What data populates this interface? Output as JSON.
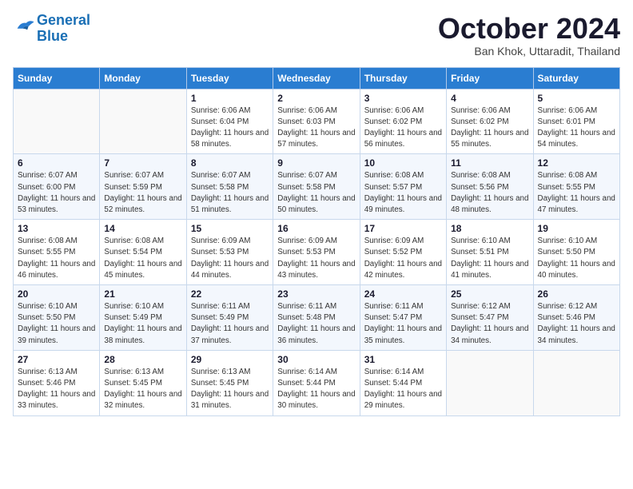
{
  "logo": {
    "line1": "General",
    "line2": "Blue"
  },
  "title": "October 2024",
  "subtitle": "Ban Khok, Uttaradit, Thailand",
  "days_header": [
    "Sunday",
    "Monday",
    "Tuesday",
    "Wednesday",
    "Thursday",
    "Friday",
    "Saturday"
  ],
  "weeks": [
    [
      {
        "day": "",
        "info": ""
      },
      {
        "day": "",
        "info": ""
      },
      {
        "day": "1",
        "info": "Sunrise: 6:06 AM\nSunset: 6:04 PM\nDaylight: 11 hours and 58 minutes."
      },
      {
        "day": "2",
        "info": "Sunrise: 6:06 AM\nSunset: 6:03 PM\nDaylight: 11 hours and 57 minutes."
      },
      {
        "day": "3",
        "info": "Sunrise: 6:06 AM\nSunset: 6:02 PM\nDaylight: 11 hours and 56 minutes."
      },
      {
        "day": "4",
        "info": "Sunrise: 6:06 AM\nSunset: 6:02 PM\nDaylight: 11 hours and 55 minutes."
      },
      {
        "day": "5",
        "info": "Sunrise: 6:06 AM\nSunset: 6:01 PM\nDaylight: 11 hours and 54 minutes."
      }
    ],
    [
      {
        "day": "6",
        "info": "Sunrise: 6:07 AM\nSunset: 6:00 PM\nDaylight: 11 hours and 53 minutes."
      },
      {
        "day": "7",
        "info": "Sunrise: 6:07 AM\nSunset: 5:59 PM\nDaylight: 11 hours and 52 minutes."
      },
      {
        "day": "8",
        "info": "Sunrise: 6:07 AM\nSunset: 5:58 PM\nDaylight: 11 hours and 51 minutes."
      },
      {
        "day": "9",
        "info": "Sunrise: 6:07 AM\nSunset: 5:58 PM\nDaylight: 11 hours and 50 minutes."
      },
      {
        "day": "10",
        "info": "Sunrise: 6:08 AM\nSunset: 5:57 PM\nDaylight: 11 hours and 49 minutes."
      },
      {
        "day": "11",
        "info": "Sunrise: 6:08 AM\nSunset: 5:56 PM\nDaylight: 11 hours and 48 minutes."
      },
      {
        "day": "12",
        "info": "Sunrise: 6:08 AM\nSunset: 5:55 PM\nDaylight: 11 hours and 47 minutes."
      }
    ],
    [
      {
        "day": "13",
        "info": "Sunrise: 6:08 AM\nSunset: 5:55 PM\nDaylight: 11 hours and 46 minutes."
      },
      {
        "day": "14",
        "info": "Sunrise: 6:08 AM\nSunset: 5:54 PM\nDaylight: 11 hours and 45 minutes."
      },
      {
        "day": "15",
        "info": "Sunrise: 6:09 AM\nSunset: 5:53 PM\nDaylight: 11 hours and 44 minutes."
      },
      {
        "day": "16",
        "info": "Sunrise: 6:09 AM\nSunset: 5:53 PM\nDaylight: 11 hours and 43 minutes."
      },
      {
        "day": "17",
        "info": "Sunrise: 6:09 AM\nSunset: 5:52 PM\nDaylight: 11 hours and 42 minutes."
      },
      {
        "day": "18",
        "info": "Sunrise: 6:10 AM\nSunset: 5:51 PM\nDaylight: 11 hours and 41 minutes."
      },
      {
        "day": "19",
        "info": "Sunrise: 6:10 AM\nSunset: 5:50 PM\nDaylight: 11 hours and 40 minutes."
      }
    ],
    [
      {
        "day": "20",
        "info": "Sunrise: 6:10 AM\nSunset: 5:50 PM\nDaylight: 11 hours and 39 minutes."
      },
      {
        "day": "21",
        "info": "Sunrise: 6:10 AM\nSunset: 5:49 PM\nDaylight: 11 hours and 38 minutes."
      },
      {
        "day": "22",
        "info": "Sunrise: 6:11 AM\nSunset: 5:49 PM\nDaylight: 11 hours and 37 minutes."
      },
      {
        "day": "23",
        "info": "Sunrise: 6:11 AM\nSunset: 5:48 PM\nDaylight: 11 hours and 36 minutes."
      },
      {
        "day": "24",
        "info": "Sunrise: 6:11 AM\nSunset: 5:47 PM\nDaylight: 11 hours and 35 minutes."
      },
      {
        "day": "25",
        "info": "Sunrise: 6:12 AM\nSunset: 5:47 PM\nDaylight: 11 hours and 34 minutes."
      },
      {
        "day": "26",
        "info": "Sunrise: 6:12 AM\nSunset: 5:46 PM\nDaylight: 11 hours and 34 minutes."
      }
    ],
    [
      {
        "day": "27",
        "info": "Sunrise: 6:13 AM\nSunset: 5:46 PM\nDaylight: 11 hours and 33 minutes."
      },
      {
        "day": "28",
        "info": "Sunrise: 6:13 AM\nSunset: 5:45 PM\nDaylight: 11 hours and 32 minutes."
      },
      {
        "day": "29",
        "info": "Sunrise: 6:13 AM\nSunset: 5:45 PM\nDaylight: 11 hours and 31 minutes."
      },
      {
        "day": "30",
        "info": "Sunrise: 6:14 AM\nSunset: 5:44 PM\nDaylight: 11 hours and 30 minutes."
      },
      {
        "day": "31",
        "info": "Sunrise: 6:14 AM\nSunset: 5:44 PM\nDaylight: 11 hours and 29 minutes."
      },
      {
        "day": "",
        "info": ""
      },
      {
        "day": "",
        "info": ""
      }
    ]
  ]
}
